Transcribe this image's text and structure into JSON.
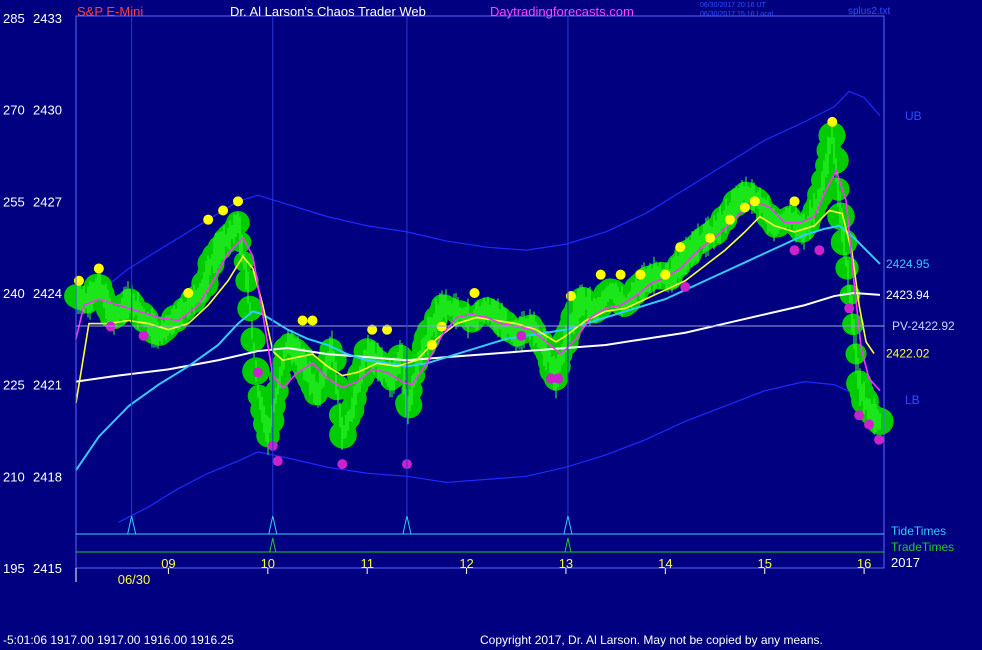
{
  "header": {
    "instrument": "S&P E-Mini",
    "site_title": "Dr. Al Larson's Chaos Trader Web",
    "site_url": "Daytradingforecasts.com",
    "stamp_line1": "06/30/2017 20:16 UT",
    "stamp_line2": "06/30/2017 15:16 Local",
    "top_right_label": "splus2.txt"
  },
  "footer": {
    "readout": "-5:01:06  1917.00 1917.00 1916.00 1916.25",
    "copyright": "Copyright 2017, Dr. Al Larson. May not be copied by any means."
  },
  "colors": {
    "background": "#000080",
    "frame": "#5a6aff",
    "band": "#1b2cff",
    "ma_cyan": "#33ccff",
    "ma_white": "#ffffff",
    "ma_yellow": "#ffff33",
    "ma_magenta": "#ff33ff",
    "price_green": "#00cc00",
    "price_fill": "#33ff33",
    "high_marker": "#ffff00",
    "low_marker": "#cc22cc",
    "tide": "#33ccff",
    "trade": "#22cc22"
  },
  "chart_data": {
    "type": "line",
    "price_range": [
      2415,
      2433
    ],
    "price_ticks": [
      {
        "price": 2433,
        "alt": "285"
      },
      {
        "price": 2430,
        "alt": "270"
      },
      {
        "price": 2427,
        "alt": "255"
      },
      {
        "price": 2424,
        "alt": "240"
      },
      {
        "price": 2421,
        "alt": "225"
      },
      {
        "price": 2418,
        "alt": "210"
      },
      {
        "price": 2415,
        "alt": "195"
      }
    ],
    "time_range": [
      8.07,
      16.16
    ],
    "hour_ticks": [
      "09",
      "10",
      "11",
      "12",
      "13",
      "14",
      "15",
      "16"
    ],
    "date_label": "06/30",
    "year_label": "2017",
    "reference_lines": [
      {
        "name": "PV-2422.92",
        "value": 2422.92
      }
    ],
    "end_labels": [
      {
        "text": "UB",
        "value": 2429.8
      },
      {
        "text": "2424.95",
        "value": 2424.95
      },
      {
        "text": "2423.94",
        "value": 2423.94
      },
      {
        "text": "2422.02",
        "value": 2422.02
      },
      {
        "text": "LB",
        "value": 2420.5
      }
    ],
    "tide_times_label": "TideTimes",
    "trade_times_label": "TradeTimes",
    "tide_times": [
      8.63,
      10.05,
      11.4,
      13.02
    ],
    "trade_times": [
      10.05,
      13.02
    ],
    "series": [
      {
        "role": "price",
        "x": [
          8.07,
          8.2,
          8.3,
          8.45,
          8.6,
          8.75,
          8.9,
          9.05,
          9.2,
          9.35,
          9.45,
          9.6,
          9.7,
          9.8,
          9.9,
          10.0,
          10.08,
          10.2,
          10.35,
          10.5,
          10.65,
          10.75,
          10.85,
          11.0,
          11.15,
          11.25,
          11.35,
          11.4,
          11.5,
          11.6,
          11.75,
          11.9,
          12.05,
          12.2,
          12.35,
          12.5,
          12.65,
          12.8,
          12.9,
          13.0,
          13.15,
          13.3,
          13.45,
          13.6,
          13.75,
          13.9,
          14.05,
          14.2,
          14.35,
          14.5,
          14.65,
          14.8,
          14.95,
          15.1,
          15.25,
          15.4,
          15.55,
          15.68,
          15.75,
          15.85,
          15.95,
          16.05,
          16.16
        ],
        "y": [
          2423.9,
          2423.7,
          2424.3,
          2423.1,
          2423.8,
          2423.2,
          2422.6,
          2423.1,
          2423.6,
          2424.1,
          2425.2,
          2425.8,
          2426.3,
          2424.2,
          2420.8,
          2419.3,
          2420.6,
          2422.4,
          2421.8,
          2420.6,
          2422.3,
          2419.3,
          2420.2,
          2422.1,
          2421.6,
          2421.1,
          2422.1,
          2420.0,
          2421.6,
          2422.5,
          2423.6,
          2423.4,
          2423.1,
          2423.5,
          2423.1,
          2422.6,
          2423.0,
          2422.1,
          2421.2,
          2422.5,
          2423.8,
          2423.4,
          2424.1,
          2423.6,
          2424.3,
          2424.6,
          2424.5,
          2425.2,
          2425.7,
          2426.0,
          2426.7,
          2427.3,
          2427.0,
          2426.2,
          2426.5,
          2426.0,
          2427.1,
          2429.2,
          2427.0,
          2424.2,
          2421.0,
          2420.1,
          2419.8
        ]
      },
      {
        "role": "fast average",
        "x": [
          8.07,
          8.15,
          8.3,
          8.5,
          8.7,
          8.9,
          9.1,
          9.3,
          9.45,
          9.6,
          9.75,
          9.85,
          9.95,
          10.05,
          10.15,
          10.3,
          10.45,
          10.6,
          10.75,
          10.9,
          11.05,
          11.2,
          11.35,
          11.45,
          11.6,
          11.75,
          11.9,
          12.05,
          12.2,
          12.35,
          12.5,
          12.65,
          12.8,
          12.95,
          13.1,
          13.25,
          13.4,
          13.55,
          13.7,
          13.85,
          14.0,
          14.15,
          14.3,
          14.45,
          14.6,
          14.75,
          14.9,
          15.05,
          15.2,
          15.35,
          15.5,
          15.62,
          15.72,
          15.82,
          15.9,
          15.97,
          16.05,
          16.16
        ],
        "y": [
          2422.5,
          2423.6,
          2423.8,
          2423.6,
          2423.4,
          2423.2,
          2423.1,
          2423.6,
          2424.4,
          2425.3,
          2425.8,
          2425.2,
          2423.3,
          2421.3,
          2420.9,
          2421.4,
          2421.7,
          2421.2,
          2420.9,
          2421.1,
          2421.5,
          2421.4,
          2421.1,
          2421.0,
          2421.7,
          2422.6,
          2423.2,
          2423.3,
          2423.2,
          2423.0,
          2422.9,
          2422.8,
          2422.4,
          2422.0,
          2422.5,
          2423.2,
          2423.5,
          2423.6,
          2423.9,
          2424.3,
          2424.5,
          2424.8,
          2425.3,
          2425.7,
          2426.1,
          2426.6,
          2427.0,
          2426.8,
          2426.3,
          2426.3,
          2426.5,
          2427.4,
          2428.0,
          2427.0,
          2424.3,
          2422.2,
          2421.2,
          2420.8
        ]
      },
      {
        "role": "medium average",
        "x": [
          8.07,
          8.2,
          8.4,
          8.6,
          8.8,
          9.0,
          9.2,
          9.4,
          9.6,
          9.75,
          9.85,
          9.95,
          10.05,
          10.15,
          10.3,
          10.45,
          10.6,
          10.75,
          10.9,
          11.1,
          11.3,
          11.5,
          11.7,
          11.9,
          12.1,
          12.3,
          12.5,
          12.7,
          12.9,
          13.0,
          13.2,
          13.4,
          13.6,
          13.8,
          14.0,
          14.2,
          14.4,
          14.6,
          14.8,
          14.95,
          15.1,
          15.3,
          15.5,
          15.65,
          15.78,
          15.88,
          15.95,
          16.02,
          16.1
        ],
        "y": [
          2420.4,
          2423.0,
          2423.0,
          2423.1,
          2423.0,
          2422.8,
          2423.0,
          2423.6,
          2424.4,
          2425.2,
          2424.8,
          2423.6,
          2422.1,
          2421.8,
          2421.9,
          2422.0,
          2421.6,
          2421.3,
          2421.4,
          2421.7,
          2421.6,
          2421.8,
          2422.5,
          2423.0,
          2423.2,
          2423.1,
          2423.0,
          2422.8,
          2422.4,
          2422.6,
          2423.1,
          2423.4,
          2423.5,
          2423.8,
          2424.1,
          2424.4,
          2424.9,
          2425.4,
          2426.0,
          2426.5,
          2426.2,
          2426.0,
          2426.2,
          2426.7,
          2426.6,
          2425.3,
          2423.6,
          2422.4,
          2422.02
        ]
      },
      {
        "role": "slow average",
        "x": [
          8.07,
          8.3,
          8.6,
          8.9,
          9.2,
          9.5,
          9.7,
          9.85,
          9.95,
          10.05,
          10.2,
          10.4,
          10.6,
          10.8,
          11.0,
          11.2,
          11.4,
          11.6,
          11.8,
          12.0,
          12.2,
          12.4,
          12.6,
          12.8,
          13.0,
          13.2,
          13.4,
          13.6,
          13.8,
          14.0,
          14.2,
          14.4,
          14.6,
          14.8,
          15.0,
          15.2,
          15.4,
          15.6,
          15.75,
          15.9,
          16.16
        ],
        "y": [
          2418.2,
          2419.3,
          2420.3,
          2421.0,
          2421.6,
          2422.3,
          2423.0,
          2423.4,
          2423.3,
          2423.1,
          2422.8,
          2422.5,
          2422.3,
          2422.0,
          2421.8,
          2421.7,
          2421.6,
          2421.7,
          2421.9,
          2422.1,
          2422.3,
          2422.5,
          2422.6,
          2422.7,
          2422.8,
          2423.0,
          2423.2,
          2423.4,
          2423.6,
          2423.8,
          2424.1,
          2424.4,
          2424.7,
          2425.0,
          2425.3,
          2425.6,
          2425.9,
          2426.1,
          2426.2,
          2425.8,
          2424.95
        ]
      },
      {
        "role": "long average",
        "x": [
          8.07,
          8.5,
          9.0,
          9.5,
          9.9,
          10.2,
          10.6,
          11.0,
          11.4,
          11.8,
          12.2,
          12.6,
          13.0,
          13.4,
          13.8,
          14.2,
          14.6,
          15.0,
          15.4,
          15.7,
          15.9,
          16.16
        ],
        "y": [
          2421.1,
          2421.3,
          2421.5,
          2421.8,
          2422.1,
          2422.2,
          2422.0,
          2421.9,
          2421.8,
          2421.9,
          2422.0,
          2422.1,
          2422.2,
          2422.3,
          2422.5,
          2422.7,
          2423.0,
          2423.3,
          2423.6,
          2423.9,
          2424.0,
          2423.94
        ]
      },
      {
        "role": "upper band",
        "x": [
          8.1,
          8.6,
          9.0,
          9.4,
          9.7,
          9.9,
          10.2,
          10.6,
          11.0,
          11.4,
          11.8,
          12.2,
          12.6,
          13.0,
          13.4,
          13.8,
          14.2,
          14.6,
          15.0,
          15.4,
          15.7,
          15.85,
          16.0,
          16.16
        ],
        "y": [
          2423.5,
          2424.8,
          2425.6,
          2426.4,
          2427.0,
          2427.2,
          2426.9,
          2426.5,
          2426.2,
          2426.0,
          2425.7,
          2425.5,
          2425.4,
          2425.6,
          2426.0,
          2426.6,
          2427.4,
          2428.2,
          2429.0,
          2429.6,
          2430.1,
          2430.6,
          2430.4,
          2429.8
        ]
      },
      {
        "role": "lower band",
        "x": [
          8.5,
          8.8,
          9.1,
          9.4,
          9.7,
          9.9,
          10.2,
          10.6,
          11.0,
          11.4,
          11.8,
          12.2,
          12.6,
          13.0,
          13.4,
          13.8,
          14.2,
          14.6,
          15.0,
          15.4,
          15.7,
          15.9,
          16.16
        ],
        "y": [
          2416.5,
          2417.0,
          2417.6,
          2418.1,
          2418.5,
          2418.8,
          2418.6,
          2418.3,
          2418.1,
          2418.0,
          2417.8,
          2417.9,
          2418.0,
          2418.3,
          2418.7,
          2419.2,
          2419.8,
          2420.3,
          2420.8,
          2421.1,
          2421.0,
          2420.7,
          2420.4
        ]
      }
    ],
    "swing_highs": [
      {
        "x": 8.1,
        "y": 2424.4
      },
      {
        "x": 8.3,
        "y": 2424.8
      },
      {
        "x": 9.2,
        "y": 2424.0
      },
      {
        "x": 9.4,
        "y": 2426.4
      },
      {
        "x": 9.55,
        "y": 2426.7
      },
      {
        "x": 9.7,
        "y": 2427.0
      },
      {
        "x": 10.35,
        "y": 2423.1
      },
      {
        "x": 10.45,
        "y": 2423.1
      },
      {
        "x": 11.05,
        "y": 2422.8
      },
      {
        "x": 11.2,
        "y": 2422.8
      },
      {
        "x": 11.65,
        "y": 2422.3
      },
      {
        "x": 11.75,
        "y": 2422.9
      },
      {
        "x": 12.08,
        "y": 2424.0
      },
      {
        "x": 13.05,
        "y": 2423.9
      },
      {
        "x": 13.35,
        "y": 2424.6
      },
      {
        "x": 13.55,
        "y": 2424.6
      },
      {
        "x": 13.75,
        "y": 2424.6
      },
      {
        "x": 14.0,
        "y": 2424.6
      },
      {
        "x": 14.15,
        "y": 2425.5
      },
      {
        "x": 14.45,
        "y": 2425.8
      },
      {
        "x": 14.65,
        "y": 2426.4
      },
      {
        "x": 14.8,
        "y": 2426.8
      },
      {
        "x": 14.9,
        "y": 2427.0
      },
      {
        "x": 15.3,
        "y": 2427.0
      },
      {
        "x": 15.68,
        "y": 2429.6
      }
    ],
    "swing_lows": [
      {
        "x": 8.42,
        "y": 2422.9
      },
      {
        "x": 8.75,
        "y": 2422.6
      },
      {
        "x": 9.9,
        "y": 2421.4
      },
      {
        "x": 10.05,
        "y": 2419.0
      },
      {
        "x": 10.1,
        "y": 2418.5
      },
      {
        "x": 10.75,
        "y": 2418.4
      },
      {
        "x": 11.4,
        "y": 2418.4
      },
      {
        "x": 12.55,
        "y": 2422.6
      },
      {
        "x": 12.85,
        "y": 2421.2
      },
      {
        "x": 12.92,
        "y": 2421.2
      },
      {
        "x": 14.2,
        "y": 2424.2
      },
      {
        "x": 15.3,
        "y": 2425.4
      },
      {
        "x": 15.55,
        "y": 2425.4
      },
      {
        "x": 15.85,
        "y": 2423.5
      },
      {
        "x": 15.95,
        "y": 2420.0
      },
      {
        "x": 16.05,
        "y": 2419.7
      },
      {
        "x": 16.15,
        "y": 2419.2
      }
    ]
  }
}
